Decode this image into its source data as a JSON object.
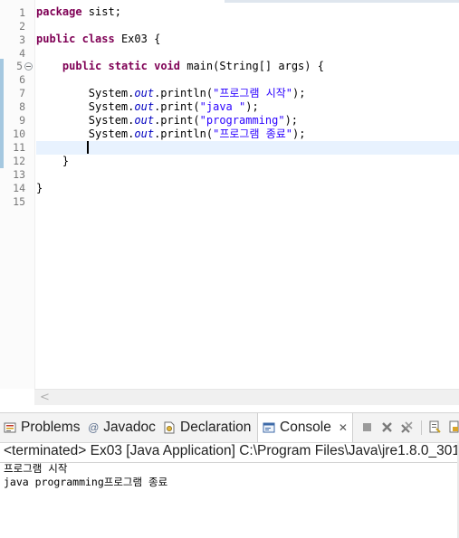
{
  "editor": {
    "line_numbers": [
      "1",
      "2",
      "3",
      "4",
      "5",
      "6",
      "7",
      "8",
      "9",
      "10",
      "11",
      "12",
      "13",
      "14",
      "15"
    ],
    "code": {
      "l1_kw": "package",
      "l1_rest": " sist;",
      "l3_kw1": "public",
      "l3_kw2": "class",
      "l3_rest": " Ex03 {",
      "l5_kw1": "public",
      "l5_kw2": "static",
      "l5_kw3": "void",
      "l5_rest": " main(String[] args) {",
      "sys": "System.",
      "out": "out",
      "l7_call": ".println(",
      "l7_str": "\"프로그램 시작\"",
      "l7_end": ");",
      "l8_call": ".print(",
      "l8_str": "\"java \"",
      "l8_end": ");",
      "l9_call": ".print(",
      "l9_str": "\"programming\"",
      "l9_end": ");",
      "l10_call": ".println(",
      "l10_str": "\"프로그램 종료\"",
      "l10_end": ");",
      "l12": "}",
      "l14": "}"
    },
    "fold_symbol": "−",
    "scroll_left": "<"
  },
  "views": {
    "tabs": [
      {
        "label": "Problems",
        "icon": "problems-icon"
      },
      {
        "label": "Javadoc",
        "icon": "javadoc-at-icon"
      },
      {
        "label": "Declaration",
        "icon": "declaration-icon"
      },
      {
        "label": "Console",
        "icon": "console-icon",
        "active": true
      }
    ],
    "close_symbol": "✕",
    "at_symbol": "@"
  },
  "console": {
    "status": "<terminated> Ex03 [Java Application] C:\\Program Files\\Java\\jre1.8.0_301",
    "output": [
      "프로그램 시작",
      "java programming프로그램 종료"
    ]
  },
  "colors": {
    "keyword": "#7f0055",
    "field": "#0000c0",
    "string": "#2a00ff",
    "current_line": "#e8f2fe"
  }
}
